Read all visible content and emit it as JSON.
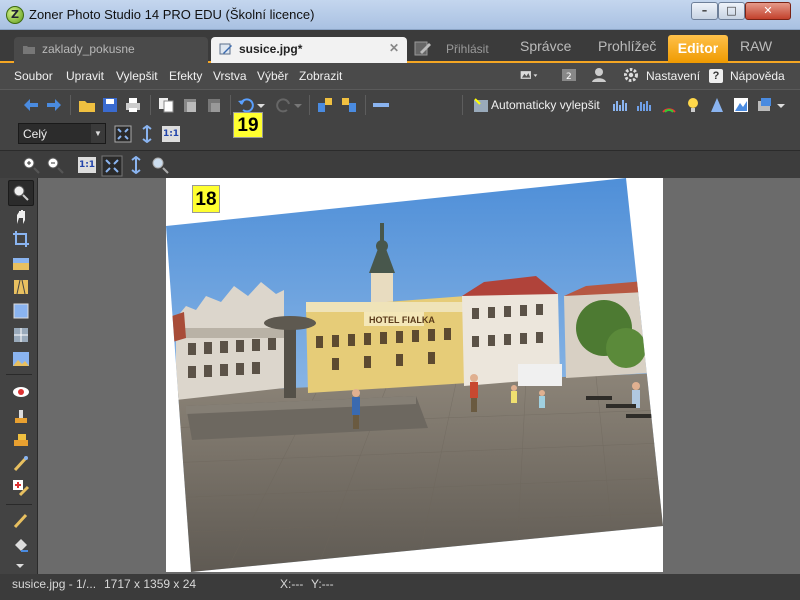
{
  "window": {
    "title": "Zoner Photo Studio 14 PRO EDU (Školní licence)",
    "app_icon_letter": "Z",
    "controls": [
      "–",
      "□",
      "✕"
    ]
  },
  "tabs": {
    "documents": [
      {
        "label": "zaklady_pokusne",
        "active": false
      },
      {
        "label": "susice.jpg*",
        "active": true
      }
    ],
    "close_glyph": "✕",
    "modules": {
      "login": "Přihlásit",
      "spravce": "Správce",
      "prohlizec": "Prohlížeč",
      "editor": "Editor",
      "raw": "RAW"
    }
  },
  "menu": {
    "items": [
      "Soubor",
      "Upravit",
      "Vylepšit",
      "Efekty",
      "Vrstva",
      "Výběr",
      "Zobrazit"
    ],
    "settings": "Nastavení",
    "help": "Nápověda",
    "help_glyph": "?"
  },
  "toolbar": {
    "auto_enhance": "Automaticky vylepšit",
    "zoom_select": "Celý",
    "zoom_1to1": "1:1"
  },
  "annotations": {
    "badge_19": "19",
    "badge_18": "18"
  },
  "photo": {
    "sign": "HOTEL FIALKA"
  },
  "status": {
    "file": "susice.jpg - 1/...",
    "dimensions": "1717 x 1359 x 24",
    "x": "X:---",
    "y": "Y:---"
  },
  "colors": {
    "accent": "#f5a623",
    "dark_bg": "#434343",
    "canvas": "#6b6b6b",
    "badge": "#ffff30"
  }
}
